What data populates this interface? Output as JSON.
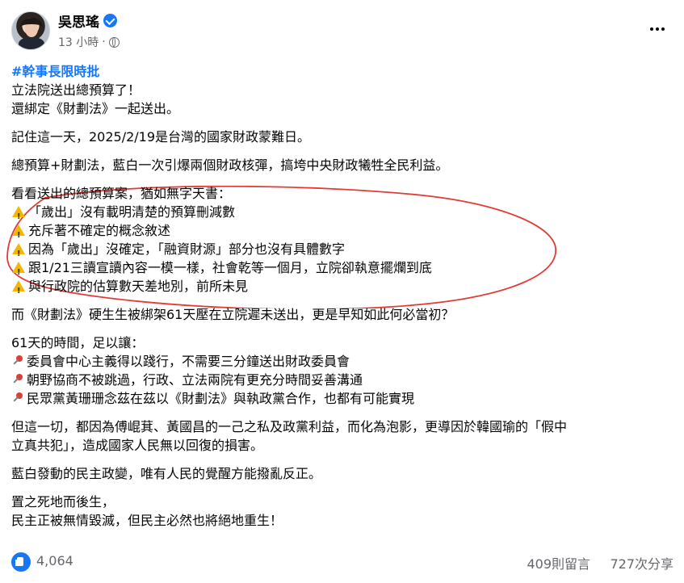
{
  "post": {
    "author": "吳思瑤",
    "time": "13 小時",
    "separator": "·",
    "icons": {
      "verified": "verified-badge",
      "privacy": "globe-icon",
      "more": "more-options-icon",
      "warning": "warning-icon",
      "pin": "round-pushpin-icon",
      "like": "like-icon"
    },
    "lines": {
      "l1": "#幹事長限時批",
      "l2": "立法院送出總預算了！",
      "l3": "還綁定《財劃法》一起送出。",
      "l4": "記住這一天，2025/2/19是台灣的國家財政蒙難日。",
      "l5": "總預算+財劃法，藍白一次引爆兩個財政核彈，搞垮中央財政犧牲全民利益。",
      "l6": "看看送出的總預算案，猶如無字天書：",
      "w1": "「歲出」沒有載明清楚的預算刪減數",
      "w2": "充斥著不確定的概念敘述",
      "w3": "因為「歲出」沒確定，「融資財源」部分也沒有具體數字",
      "w4": "跟1/21三讀宣讀內容一模一樣，社會乾等一個月，立院卻執意擺爛到底",
      "w5": "與行政院的估算數天差地別，前所未見",
      "l7": "而《財劃法》硬生生被綁架61天壓在立院遲未送出，更是早知如此何必當初？",
      "l8": "61天的時間，足以讓：",
      "p1": "委員會中心主義得以踐行，不需要三分鐘送出財政委員會",
      "p2": "朝野協商不被跳過，行政、立法兩院有更充分時間妥善溝通",
      "p3": "民眾黨黃珊珊念茲在茲以《財劃法》與執政黨合作，也都有可能實現",
      "l9a": "但這一切，都因為傅崐萁、黃國昌的一己之私及政黨利益，而化為泡影，更導因於韓國瑜的「假中",
      "l9b": "立真共犯」，造成國家人民無以回復的損害。",
      "l10": "藍白發動的民主政變，唯有人民的覺醒方能撥亂反正。",
      "l11": "置之死地而後生，",
      "l12": "民主正被無情毀滅，但民主必然也將絕地重生！"
    },
    "stats": {
      "likes": "4,064",
      "comments": "409則留言",
      "shares": "727次分享"
    },
    "colors": {
      "accent": "#1877f2",
      "annotation": "#e23b36",
      "secondary_text": "#65676b"
    }
  }
}
